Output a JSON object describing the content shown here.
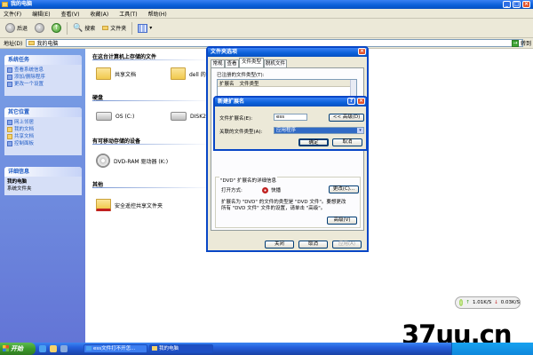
{
  "window": {
    "title": "我的电脑"
  },
  "menubar": [
    "文件(F)",
    "编辑(E)",
    "查看(V)",
    "收藏(A)",
    "工具(T)",
    "帮助(H)"
  ],
  "toolbar": {
    "back": "后退",
    "search": "搜索",
    "folders": "文件夹"
  },
  "address": {
    "label": "地址(D)",
    "value": "我的电脑",
    "go": "转到"
  },
  "sidebar": {
    "system_tasks": {
      "title": "系统任务",
      "items": [
        "查看系统信息",
        "添加/删除程序",
        "更改一个设置"
      ]
    },
    "other_places": {
      "title": "其它位置",
      "items": [
        "网上邻居",
        "我的文档",
        "共享文档",
        "控制面板"
      ]
    },
    "details": {
      "title": "详细信息",
      "name": "我的电脑",
      "desc": "系统文件夹"
    }
  },
  "content": {
    "section_files": "在这台计算机上存储的文件",
    "shared_docs": "共享文档",
    "dell_docs": "dell 的文档",
    "section_hdd": "硬盘",
    "drive_c": "OS (C:)",
    "drive_d": "DISK2_VOL",
    "section_removable": "有可移动存储的设备",
    "dvd": "DVD-RAM 驱动器 (K:)",
    "section_other": "其他",
    "safe_share": "安全遥控共享文件夹"
  },
  "folder_options": {
    "title": "文件夹选项",
    "tabs": [
      "常规",
      "查看",
      "文件类型",
      "脱机文件"
    ],
    "registered_label": "已注册的文件类型(T):",
    "col_ext": "扩展名",
    "col_type": "文件类型",
    "details_title": "\"DVD\" 扩展名的详细信息",
    "opens_with_label": "打开方式:",
    "opens_with_value": "快播",
    "change_btn": "更改(C)...",
    "desc_line1": "扩展名为 \"DVD\" 的文件的类型是 \"DVD 文件\"。要想更改",
    "desc_line2": "所有 \"DVD 文件\" 文件的设置，请单击 \"高级\"。",
    "advanced_btn": "高级(V)",
    "close_btn": "关闭",
    "cancel_btn": "取消",
    "apply_btn": "应用(A)"
  },
  "new_ext": {
    "title": "新建扩展名",
    "ext_label": "文件扩展名(E):",
    "ext_value": "ess",
    "advanced_btn": "<< 高级(D)",
    "assoc_label": "关联的文件类型(A):",
    "assoc_value": "应用程序",
    "ok_btn": "确定",
    "cancel_btn": "取消"
  },
  "net_meter": {
    "up": "1.01K/S",
    "down": "0.03K/S"
  },
  "taskbar": {
    "start": "开始",
    "tasks": [
      "ess文件打不开怎...",
      "我的电脑"
    ]
  },
  "watermark": "37uu.cn"
}
